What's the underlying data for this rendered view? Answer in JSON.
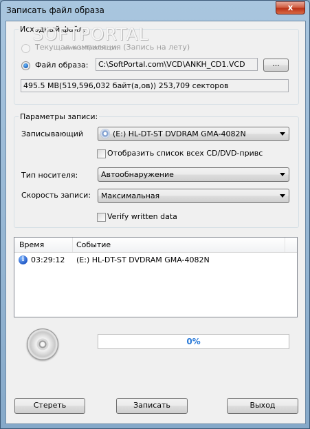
{
  "window": {
    "title": "Записать файл образа",
    "close_glyph": "x"
  },
  "source": {
    "legend": "Исходный файл:",
    "radio_current": "Текущая компиляция (Запись на лету)",
    "radio_image": "Файл образа:",
    "image_path": "C:\\SoftPortal.com\\VCD\\ANKH_CD1.VCD",
    "browse_label": "...",
    "size_info": "495.5 MB(519,596,032 байт(а,ов))  253,709 секторов"
  },
  "watermark": {
    "text": "SOFTPORTAL",
    "url": "www.softportal.com"
  },
  "record": {
    "legend": "Параметры записи:",
    "writer_label": "Записывающий",
    "writer_value": "(E:) HL-DT-ST DVDRAM GMA-4082N",
    "show_all_label": "Отобразить список всех CD/DVD-привс",
    "media_label": "Тип носителя:",
    "media_value": "Автообнаружение",
    "speed_label": "Скорость записи:",
    "speed_value": "Максимальная",
    "verify_label": "Verify written data"
  },
  "log": {
    "columns": [
      "Время",
      "Событие"
    ],
    "rows": [
      {
        "time": "03:29:12",
        "event": "(E:) HL-DT-ST DVDRAM GMA-4082N",
        "icon": "info-icon"
      }
    ]
  },
  "progress": {
    "percent": 0,
    "text": "0%"
  },
  "buttons": {
    "erase": "Стереть",
    "write": "Записать",
    "exit": "Выход"
  },
  "colors": {
    "progress_text": "#2a7ad8",
    "close_button": "#c8482a"
  }
}
